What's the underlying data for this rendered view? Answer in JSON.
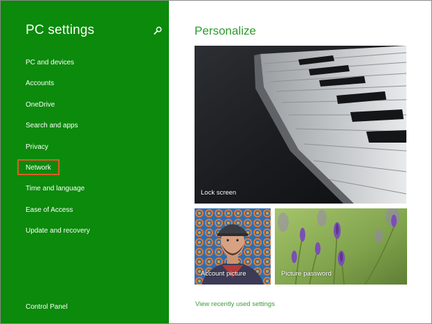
{
  "sidebar": {
    "title": "PC settings",
    "search_icon": "search-icon",
    "items": [
      {
        "label": "PC and devices"
      },
      {
        "label": "Accounts"
      },
      {
        "label": "OneDrive"
      },
      {
        "label": "Search and apps"
      },
      {
        "label": "Privacy"
      },
      {
        "label": "Network",
        "selected": true
      },
      {
        "label": "Time and language"
      },
      {
        "label": "Ease of Access"
      },
      {
        "label": "Update and recovery"
      }
    ],
    "control_panel": "Control Panel"
  },
  "main": {
    "title": "Personalize",
    "tiles": {
      "lock_screen": "Lock screen",
      "account_picture": "Account picture",
      "picture_password": "Picture password"
    },
    "recent_link": "View recently used settings"
  },
  "colors": {
    "sidebar_bg": "#0b8a0b",
    "accent_green": "#2e9b2e",
    "selection_outline": "#e05a2b"
  }
}
